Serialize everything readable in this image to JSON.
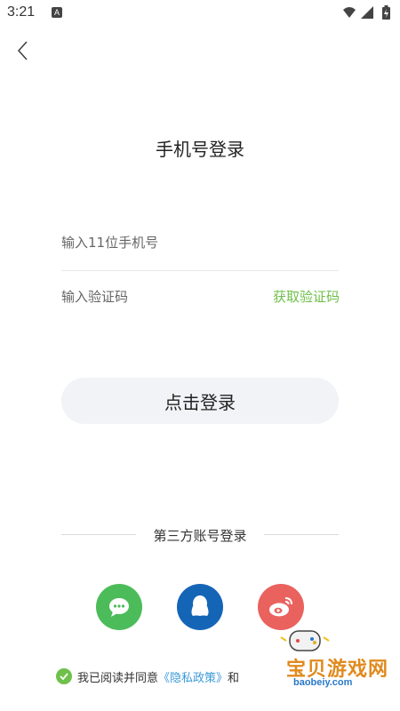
{
  "status_bar": {
    "time": "3:21",
    "notification_glyph": "A"
  },
  "header": {
    "back_icon": "chevron-left-icon"
  },
  "title": "手机号登录",
  "phone": {
    "placeholder": "输入11位手机号",
    "value": ""
  },
  "code": {
    "placeholder": "输入验证码",
    "value": "",
    "get_code_label": "获取验证码"
  },
  "login_button": {
    "label": "点击登录"
  },
  "third_party": {
    "label": "第三方账号登录",
    "providers": [
      "wechat-icon",
      "qq-icon",
      "weibo-icon"
    ]
  },
  "agreement": {
    "prefix": "我已阅读并同意",
    "privacy_link": "《隐私政策》",
    "connector": "和",
    "checked": true
  },
  "watermark": {
    "title": "宝贝游戏网",
    "domain": "baobeiy.com"
  },
  "colors": {
    "accent_green": "#6ec04a",
    "wechat": "#4cbc5a",
    "qq": "#1565b7",
    "weibo": "#e9625e",
    "link_blue": "#3a9ad9"
  }
}
